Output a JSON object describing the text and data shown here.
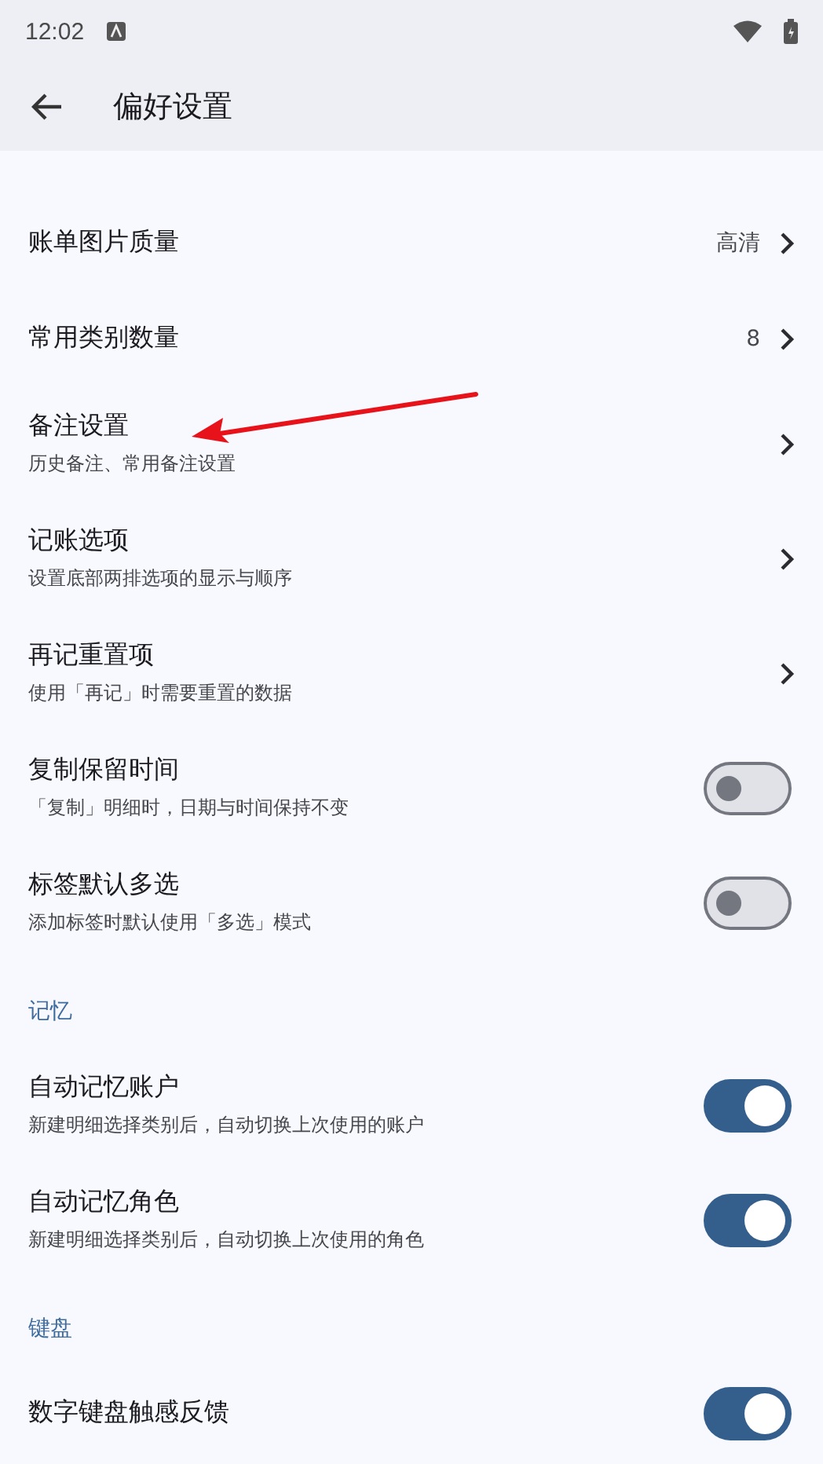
{
  "status_bar": {
    "time": "12:02"
  },
  "app_bar": {
    "title": "偏好设置"
  },
  "sections": [
    {
      "items": [
        {
          "kind": "link",
          "title": "账单图片质量",
          "value": "高清"
        },
        {
          "kind": "link",
          "title": "常用类别数量",
          "value": "8"
        },
        {
          "kind": "link",
          "title": "备注设置",
          "subtitle": "历史备注、常用备注设置"
        },
        {
          "kind": "link",
          "title": "记账选项",
          "subtitle": "设置底部两排选项的显示与顺序"
        },
        {
          "kind": "link",
          "title": "再记重置项",
          "subtitle": "使用「再记」时需要重置的数据"
        },
        {
          "kind": "switch",
          "title": "复制保留时间",
          "subtitle": "「复制」明细时，日期与时间保持不变",
          "on": false
        },
        {
          "kind": "switch",
          "title": "标签默认多选",
          "subtitle": "添加标签时默认使用「多选」模式",
          "on": false
        }
      ]
    },
    {
      "header": "记忆",
      "items": [
        {
          "kind": "switch",
          "title": "自动记忆账户",
          "subtitle": "新建明细选择类别后，自动切换上次使用的账户",
          "on": true
        },
        {
          "kind": "switch",
          "title": "自动记忆角色",
          "subtitle": "新建明细选择类别后，自动切换上次使用的角色",
          "on": true
        }
      ]
    },
    {
      "header": "键盘",
      "items": [
        {
          "kind": "switch",
          "title": "数字键盘触感反馈",
          "on": true
        }
      ]
    }
  ]
}
